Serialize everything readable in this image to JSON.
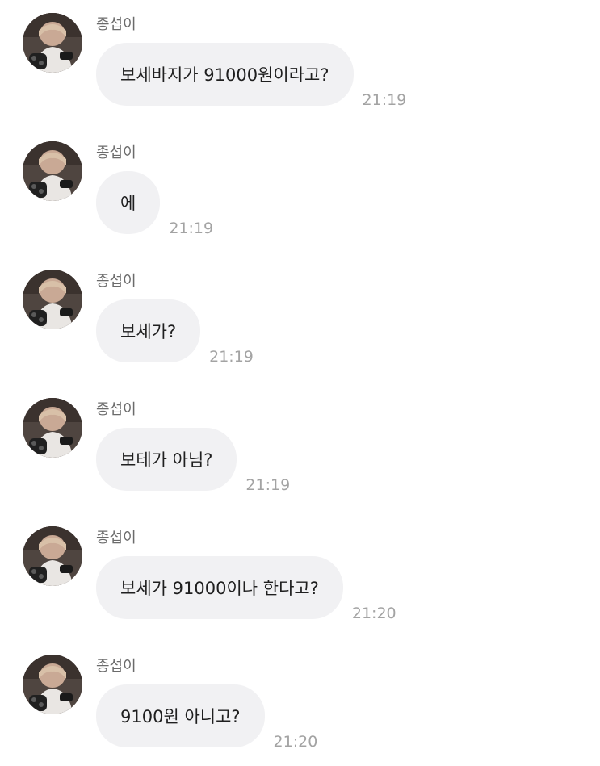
{
  "chat": {
    "messages": [
      {
        "sender": "종섭이",
        "avatar": "profile-photo",
        "text": "보세바지가 91000원이라고?",
        "time": "21:19"
      },
      {
        "sender": "종섭이",
        "avatar": "profile-photo",
        "text": "에",
        "time": "21:19"
      },
      {
        "sender": "종섭이",
        "avatar": "profile-photo",
        "text": "보세가?",
        "time": "21:19"
      },
      {
        "sender": "종섭이",
        "avatar": "profile-photo",
        "text": "보테가 아님?",
        "time": "21:19"
      },
      {
        "sender": "종섭이",
        "avatar": "profile-photo",
        "text": "보세가 91000이나 한다고?",
        "time": "21:20"
      },
      {
        "sender": "종섭이",
        "avatar": "profile-photo",
        "text": "9100원 아니고?",
        "time": "21:20"
      }
    ]
  },
  "colors": {
    "bubble": "#f1f1f3",
    "message_text": "#1f1f1f",
    "sender_text": "#6b6b6b",
    "time_text": "#a3a3a3",
    "background": "#ffffff"
  }
}
